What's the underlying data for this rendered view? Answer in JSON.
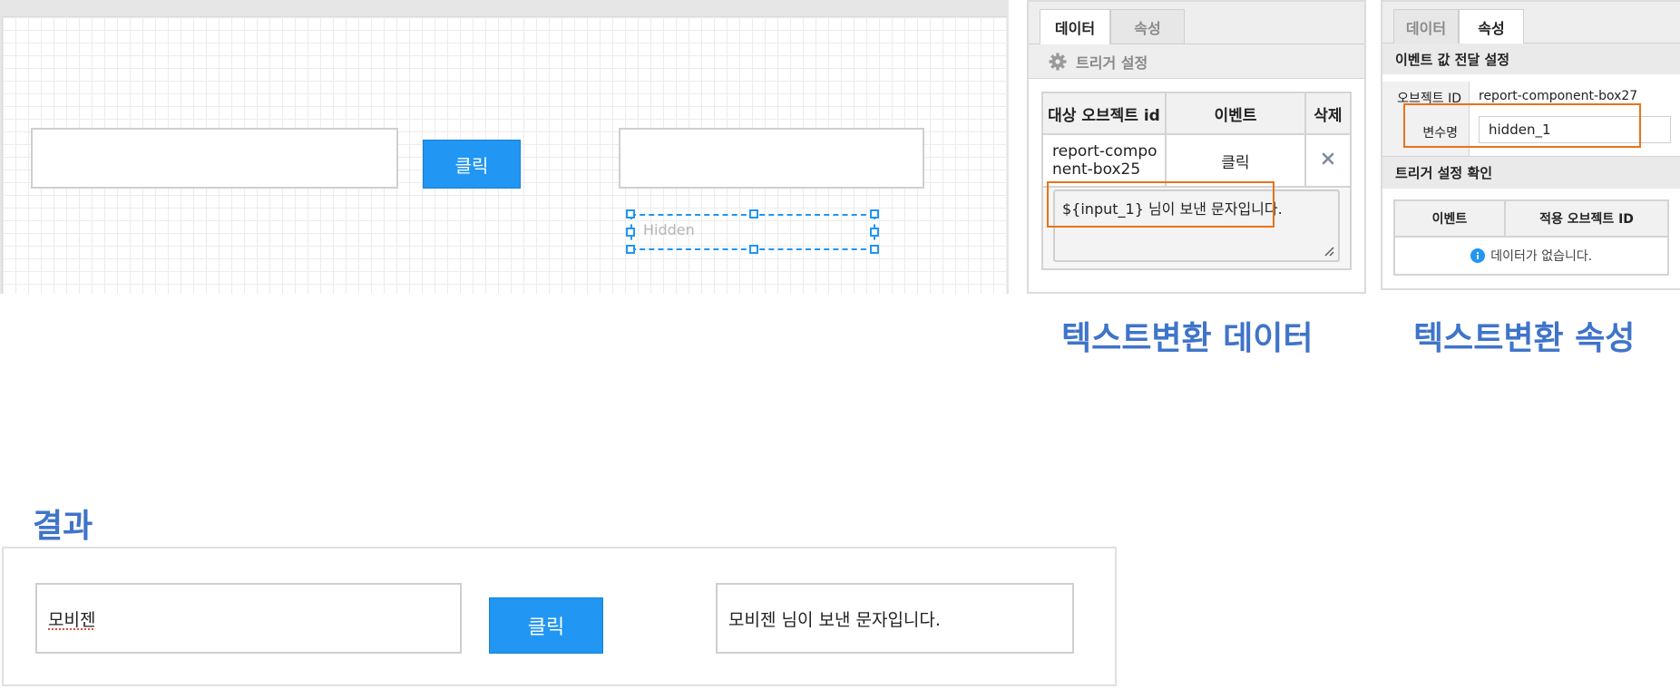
{
  "canvas": {
    "button_label": "클릭",
    "hidden_placeholder": "Hidden"
  },
  "data_panel": {
    "tabs": [
      {
        "label": "데이터",
        "active": true
      },
      {
        "label": "속성",
        "active": false
      }
    ],
    "trigger_settings_label": "트리거 설정",
    "table": {
      "headers": [
        "대상 오브젝트 id",
        "이벤트",
        "삭제"
      ],
      "rows": [
        {
          "target": "report-compo\nnent-box25",
          "event": "클릭"
        }
      ]
    },
    "template_text": "${input_1} 님이 보낸 문자입니다."
  },
  "prop_panel": {
    "tabs": [
      {
        "label": "데이터",
        "active": false
      },
      {
        "label": "속성",
        "active": true
      }
    ],
    "event_pass_header": "이벤트 값 전달 설정",
    "object_id_label": "오브젝트 ID",
    "object_id_value": "report-component-box27",
    "var_name_label": "변수명",
    "var_name_value": "hidden_1",
    "trigger_confirm_header": "트리거 설정 확인",
    "table_headers": [
      "이벤트",
      "적용 오브젝트 ID"
    ],
    "empty_text": "데이터가 없습니다."
  },
  "labels": {
    "data_caption": "텍스트변환 데이터",
    "prop_caption": "텍스트변환 속성",
    "result_title": "결과"
  },
  "result": {
    "input_value": "모비젠",
    "button_label": "클릭",
    "output_value": "모비젠 님이 보낸 문자입니다."
  },
  "colors": {
    "accent": "#2196f3",
    "highlight": "#e8731b",
    "caption": "#3f74c9"
  }
}
